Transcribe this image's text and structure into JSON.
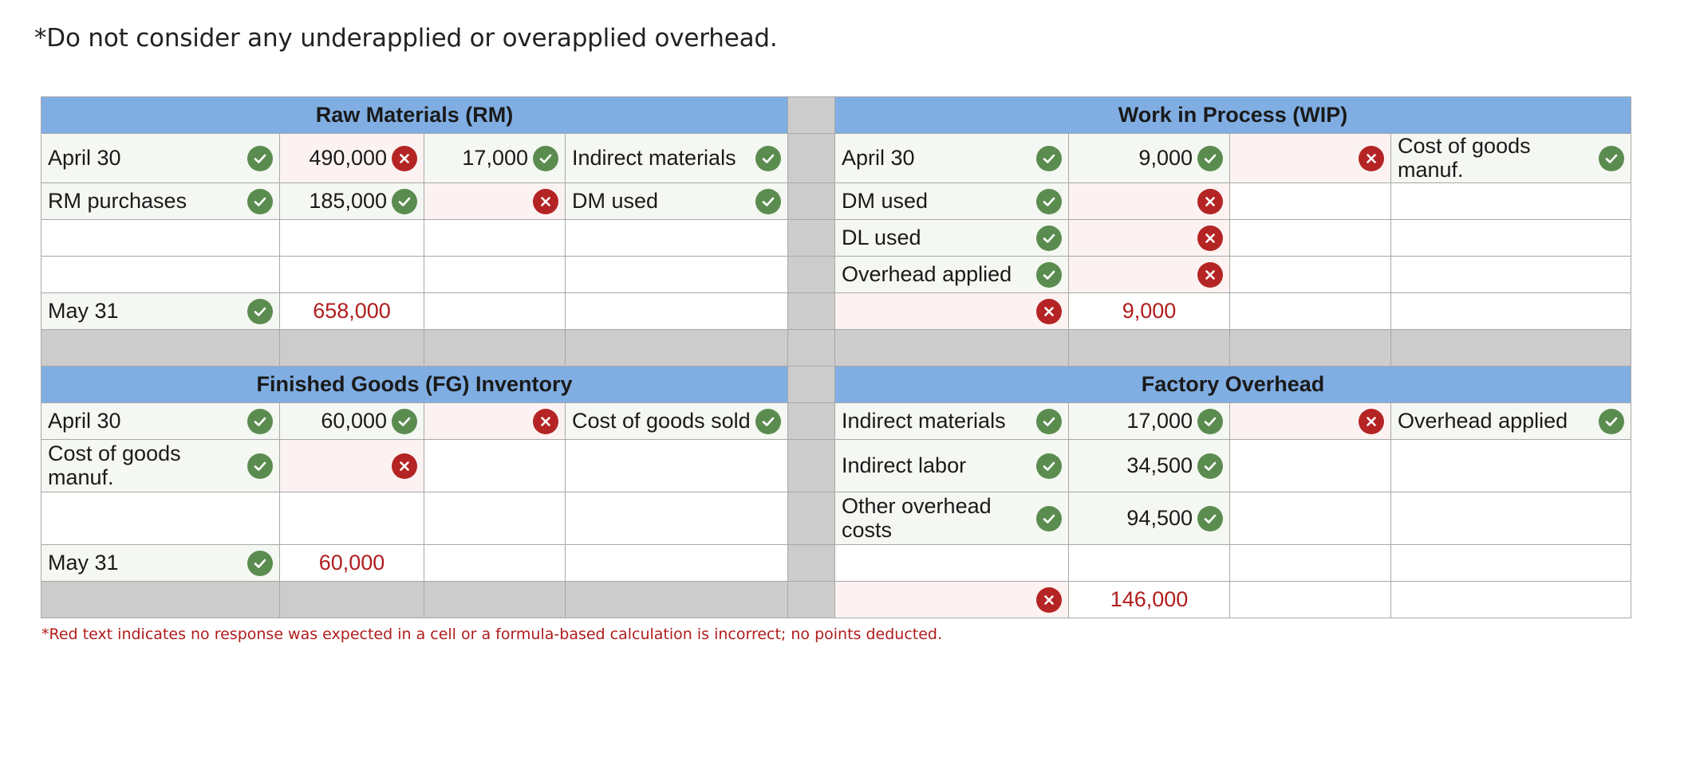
{
  "notes": {
    "top": "*Do not consider any underapplied or overapplied overhead.",
    "bottom": "*Red text indicates no response was expected in a cell or a formula-based calculation is incorrect; no points deducted."
  },
  "rm": {
    "title": "Raw Materials (RM)",
    "r1": {
      "label": "April 30",
      "debit": "490,000",
      "credit": "17,000",
      "credit_label": "Indirect materials"
    },
    "r2": {
      "label": "RM purchases",
      "debit": "185,000",
      "credit": "",
      "credit_label": "DM used"
    },
    "r5": {
      "label": "May 31",
      "balance": "658,000"
    }
  },
  "wip": {
    "title": "Work in Process (WIP)",
    "r1": {
      "label": "April 30",
      "debit": "9,000",
      "credit": "",
      "credit_label": "Cost of goods manuf."
    },
    "r2": {
      "label": "DM used",
      "debit": ""
    },
    "r3": {
      "label": "DL used",
      "debit": ""
    },
    "r4": {
      "label": "Overhead applied",
      "debit": ""
    },
    "r5": {
      "label": "",
      "balance": "9,000"
    }
  },
  "fg": {
    "title": "Finished Goods (FG) Inventory",
    "r1": {
      "label": "April 30",
      "debit": "60,000",
      "credit": "",
      "credit_label": "Cost of goods sold"
    },
    "r2": {
      "label": "Cost of goods manuf.",
      "debit": ""
    },
    "r4": {
      "label": "May 31",
      "balance": "60,000"
    }
  },
  "foh": {
    "title": "Factory Overhead",
    "r1": {
      "label": "Indirect materials",
      "debit": "17,000",
      "credit": "",
      "credit_label": "Overhead applied"
    },
    "r2": {
      "label": "Indirect labor",
      "debit": "34,500"
    },
    "r3": {
      "label": "Other overhead costs",
      "debit": "94,500"
    },
    "r5": {
      "label": "",
      "balance": "146,000"
    }
  },
  "colors": {
    "header": "#80aee3",
    "check": "#5b8c4f",
    "cross": "#b52424",
    "red_text": "#b01c1c",
    "separator": "#cccccc"
  },
  "icons": {
    "ok": "check-icon",
    "bad": "cross-icon"
  }
}
